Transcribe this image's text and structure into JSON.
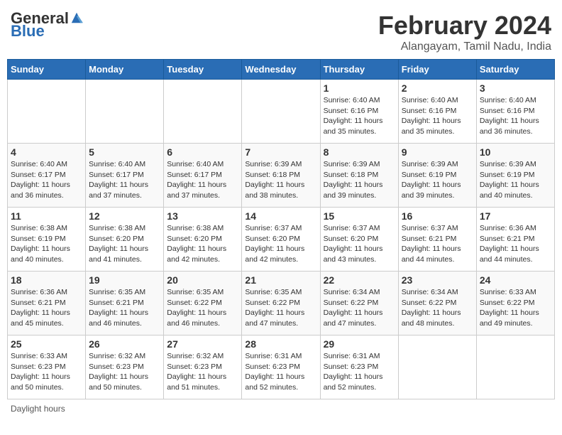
{
  "header": {
    "logo_general": "General",
    "logo_blue": "Blue",
    "main_title": "February 2024",
    "subtitle": "Alangayam, Tamil Nadu, India"
  },
  "calendar": {
    "days_of_week": [
      "Sunday",
      "Monday",
      "Tuesday",
      "Wednesday",
      "Thursday",
      "Friday",
      "Saturday"
    ],
    "weeks": [
      [
        {
          "day": "",
          "info": ""
        },
        {
          "day": "",
          "info": ""
        },
        {
          "day": "",
          "info": ""
        },
        {
          "day": "",
          "info": ""
        },
        {
          "day": "1",
          "info": "Sunrise: 6:40 AM\nSunset: 6:16 PM\nDaylight: 11 hours and 35 minutes."
        },
        {
          "day": "2",
          "info": "Sunrise: 6:40 AM\nSunset: 6:16 PM\nDaylight: 11 hours and 35 minutes."
        },
        {
          "day": "3",
          "info": "Sunrise: 6:40 AM\nSunset: 6:16 PM\nDaylight: 11 hours and 36 minutes."
        }
      ],
      [
        {
          "day": "4",
          "info": "Sunrise: 6:40 AM\nSunset: 6:17 PM\nDaylight: 11 hours and 36 minutes."
        },
        {
          "day": "5",
          "info": "Sunrise: 6:40 AM\nSunset: 6:17 PM\nDaylight: 11 hours and 37 minutes."
        },
        {
          "day": "6",
          "info": "Sunrise: 6:40 AM\nSunset: 6:17 PM\nDaylight: 11 hours and 37 minutes."
        },
        {
          "day": "7",
          "info": "Sunrise: 6:39 AM\nSunset: 6:18 PM\nDaylight: 11 hours and 38 minutes."
        },
        {
          "day": "8",
          "info": "Sunrise: 6:39 AM\nSunset: 6:18 PM\nDaylight: 11 hours and 39 minutes."
        },
        {
          "day": "9",
          "info": "Sunrise: 6:39 AM\nSunset: 6:19 PM\nDaylight: 11 hours and 39 minutes."
        },
        {
          "day": "10",
          "info": "Sunrise: 6:39 AM\nSunset: 6:19 PM\nDaylight: 11 hours and 40 minutes."
        }
      ],
      [
        {
          "day": "11",
          "info": "Sunrise: 6:38 AM\nSunset: 6:19 PM\nDaylight: 11 hours and 40 minutes."
        },
        {
          "day": "12",
          "info": "Sunrise: 6:38 AM\nSunset: 6:20 PM\nDaylight: 11 hours and 41 minutes."
        },
        {
          "day": "13",
          "info": "Sunrise: 6:38 AM\nSunset: 6:20 PM\nDaylight: 11 hours and 42 minutes."
        },
        {
          "day": "14",
          "info": "Sunrise: 6:37 AM\nSunset: 6:20 PM\nDaylight: 11 hours and 42 minutes."
        },
        {
          "day": "15",
          "info": "Sunrise: 6:37 AM\nSunset: 6:20 PM\nDaylight: 11 hours and 43 minutes."
        },
        {
          "day": "16",
          "info": "Sunrise: 6:37 AM\nSunset: 6:21 PM\nDaylight: 11 hours and 44 minutes."
        },
        {
          "day": "17",
          "info": "Sunrise: 6:36 AM\nSunset: 6:21 PM\nDaylight: 11 hours and 44 minutes."
        }
      ],
      [
        {
          "day": "18",
          "info": "Sunrise: 6:36 AM\nSunset: 6:21 PM\nDaylight: 11 hours and 45 minutes."
        },
        {
          "day": "19",
          "info": "Sunrise: 6:35 AM\nSunset: 6:21 PM\nDaylight: 11 hours and 46 minutes."
        },
        {
          "day": "20",
          "info": "Sunrise: 6:35 AM\nSunset: 6:22 PM\nDaylight: 11 hours and 46 minutes."
        },
        {
          "day": "21",
          "info": "Sunrise: 6:35 AM\nSunset: 6:22 PM\nDaylight: 11 hours and 47 minutes."
        },
        {
          "day": "22",
          "info": "Sunrise: 6:34 AM\nSunset: 6:22 PM\nDaylight: 11 hours and 47 minutes."
        },
        {
          "day": "23",
          "info": "Sunrise: 6:34 AM\nSunset: 6:22 PM\nDaylight: 11 hours and 48 minutes."
        },
        {
          "day": "24",
          "info": "Sunrise: 6:33 AM\nSunset: 6:22 PM\nDaylight: 11 hours and 49 minutes."
        }
      ],
      [
        {
          "day": "25",
          "info": "Sunrise: 6:33 AM\nSunset: 6:23 PM\nDaylight: 11 hours and 50 minutes."
        },
        {
          "day": "26",
          "info": "Sunrise: 6:32 AM\nSunset: 6:23 PM\nDaylight: 11 hours and 50 minutes."
        },
        {
          "day": "27",
          "info": "Sunrise: 6:32 AM\nSunset: 6:23 PM\nDaylight: 11 hours and 51 minutes."
        },
        {
          "day": "28",
          "info": "Sunrise: 6:31 AM\nSunset: 6:23 PM\nDaylight: 11 hours and 52 minutes."
        },
        {
          "day": "29",
          "info": "Sunrise: 6:31 AM\nSunset: 6:23 PM\nDaylight: 11 hours and 52 minutes."
        },
        {
          "day": "",
          "info": ""
        },
        {
          "day": "",
          "info": ""
        }
      ]
    ]
  },
  "footer": {
    "daylight_hours_label": "Daylight hours"
  }
}
